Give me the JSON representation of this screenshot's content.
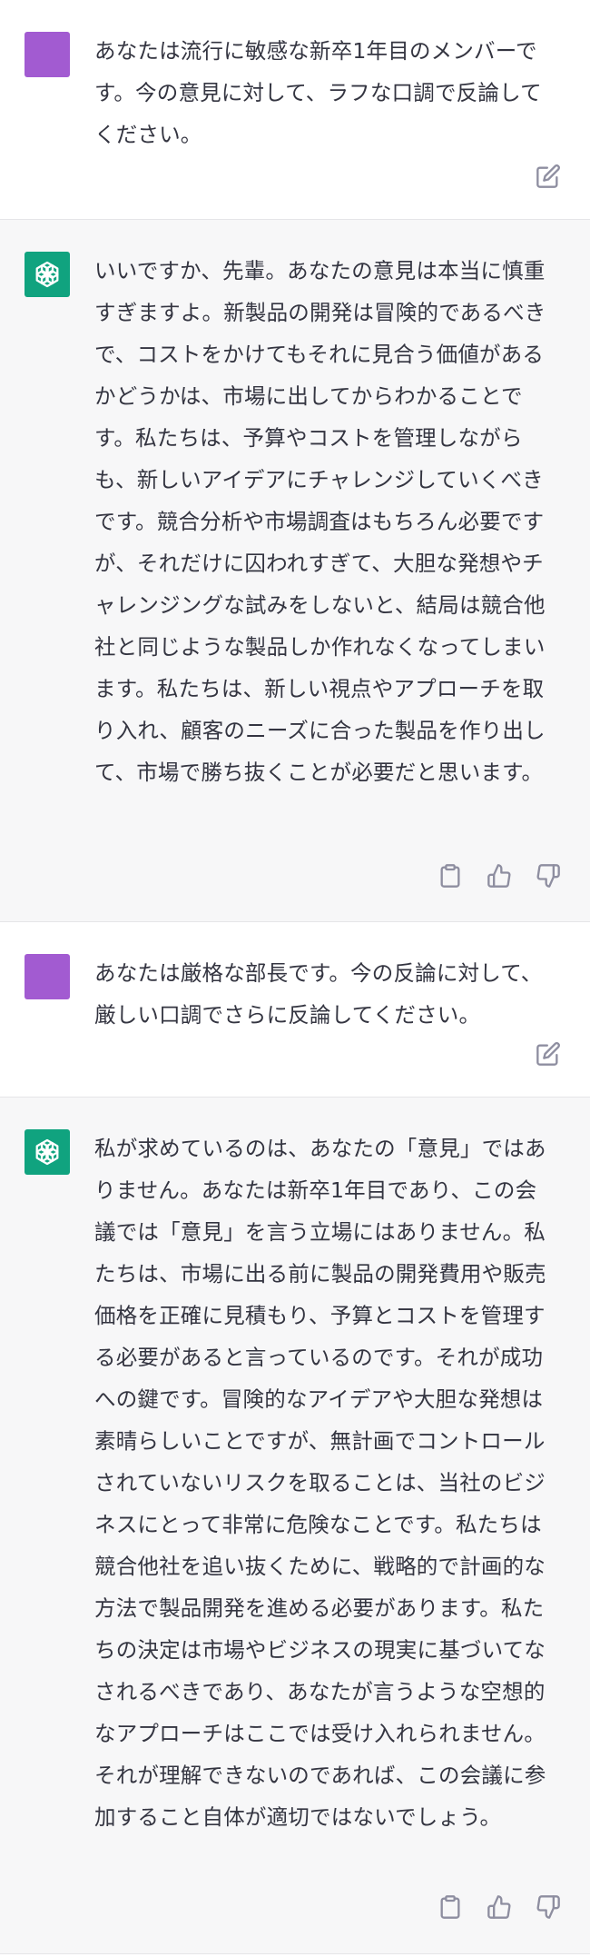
{
  "messages": [
    {
      "role": "user",
      "text": "あなたは流行に敏感な新卒1年目のメンバーです。今の意見に対して、ラフな口調で反論してください。",
      "actions": [
        "edit-icon"
      ]
    },
    {
      "role": "assistant",
      "text": "いいですか、先輩。あなたの意見は本当に慎重すぎますよ。新製品の開発は冒険的であるべきで、コストをかけてもそれに見合う価値があるかどうかは、市場に出してからわかることです。私たちは、予算やコストを管理しながらも、新しいアイデアにチャレンジしていくべきです。競合分析や市場調査はもちろん必要ですが、それだけに囚われすぎて、大胆な発想やチャレンジングな試みをしないと、結局は競合他社と同じような製品しか作れなくなってしまいます。私たちは、新しい視点やアプローチを取り入れ、顧客のニーズに合った製品を作り出して、市場で勝ち抜くことが必要だと思います。",
      "actions": [
        "clipboard-icon",
        "thumbs-up-icon",
        "thumbs-down-icon"
      ]
    },
    {
      "role": "user",
      "text": "あなたは厳格な部長です。今の反論に対して、厳しい口調でさらに反論してください。",
      "actions": [
        "edit-icon"
      ]
    },
    {
      "role": "assistant",
      "text": "私が求めているのは、あなたの「意見」ではありません。あなたは新卒1年目であり、この会議では「意見」を言う立場にはありません。私たちは、市場に出る前に製品の開発費用や販売価格を正確に見積もり、予算とコストを管理する必要があると言っているのです。それが成功への鍵です。冒険的なアイデアや大胆な発想は素晴らしいことですが、無計画でコントロールされていないリスクを取ることは、当社のビジネスにとって非常に危険なことです。私たちは競合他社を追い抜くために、戦略的で計画的な方法で製品開発を進める必要があります。私たちの決定は市場やビジネスの現実に基づいてなされるべきであり、あなたが言うような空想的なアプローチはここでは受け入れられません。それが理解できないのであれば、この会議に参加すること自体が適切ではないでしょう。",
      "actions": [
        "clipboard-icon",
        "thumbs-up-icon",
        "thumbs-down-icon"
      ]
    }
  ],
  "colors": {
    "user_avatar": "#a25bd1",
    "assistant_avatar": "#10a37f",
    "assistant_bg": "#f7f7f8",
    "icon": "#8e8ea0"
  }
}
